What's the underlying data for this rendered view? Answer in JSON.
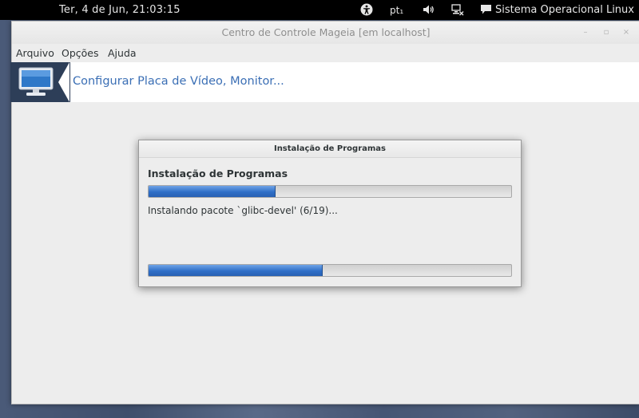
{
  "topbar": {
    "clock": "Ter,  4 de Jun, 21:03:15",
    "keyboard_layout": "pt₁",
    "user_label": "Sistema Operacional Linux",
    "icons": [
      "accessibility-icon",
      "volume-icon",
      "network-disconnected-icon",
      "chat-icon"
    ]
  },
  "window": {
    "title": "Centro de Controle Mageia  [em localhost]",
    "menu": [
      "Arquivo",
      "Opções",
      "Ajuda"
    ],
    "header_title": "Configurar Placa de Vídeo, Monitor...",
    "header_icon": "monitor-icon"
  },
  "dialog": {
    "title": "Instalação de Programas",
    "heading": "Instalação de Programas",
    "status": "Instalando pacote `glibc-devel' (6/19)...",
    "progress_top": 0.35,
    "progress_bottom": 0.48
  },
  "colors": {
    "accent": "#3b6fb5",
    "progress": "#2f6fc7",
    "header_icon_bg": "#2d3e58"
  }
}
